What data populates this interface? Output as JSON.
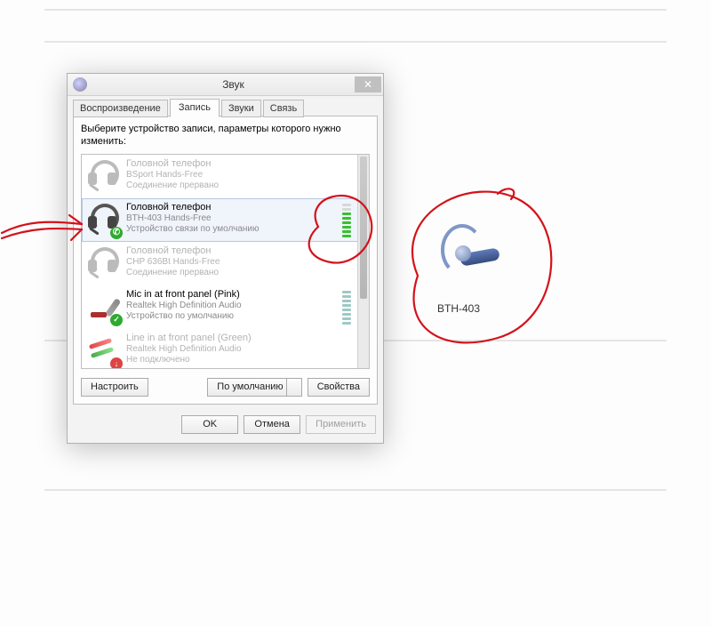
{
  "window": {
    "title": "Звук",
    "tabs": [
      "Воспроизведение",
      "Запись",
      "Звуки",
      "Связь"
    ],
    "active_tab_index": 1,
    "instruction": "Выберите устройство записи, параметры которого нужно изменить:"
  },
  "devices": [
    {
      "name": "Головной телефон",
      "subtitle": "BSport Hands-Free",
      "status": "Соединение прервано",
      "icon": "headset-icon",
      "faded": true,
      "meter": null,
      "badge": null
    },
    {
      "name": "Головной телефон",
      "subtitle": "BTH-403 Hands-Free",
      "status": "Устройство связи по умолчанию",
      "icon": "headset-icon",
      "faded": false,
      "meter": "green",
      "badge": "phone",
      "selected": true
    },
    {
      "name": "Головной телефон",
      "subtitle": "CHP 636Bt Hands-Free",
      "status": "Соединение прервано",
      "icon": "headset-icon",
      "faded": true,
      "meter": null,
      "badge": null
    },
    {
      "name": "Mic in at front panel (Pink)",
      "subtitle": "Realtek High Definition Audio",
      "status": "Устройство по умолчанию",
      "icon": "mic-icon",
      "faded": false,
      "meter": "teal",
      "badge": "check"
    },
    {
      "name": "Line in at front panel (Green)",
      "subtitle": "Realtek High Definition Audio",
      "status": "Не подключено",
      "icon": "line-in-icon",
      "faded": true,
      "meter": null,
      "badge": "no"
    }
  ],
  "buttons": {
    "configure": "Настроить",
    "set_default": "По умолчанию",
    "properties": "Свойства",
    "ok": "OK",
    "cancel": "Отмена",
    "apply": "Применить"
  },
  "bluetooth_label": "BTH-403",
  "colors": {
    "annotation": "#d4111a"
  }
}
